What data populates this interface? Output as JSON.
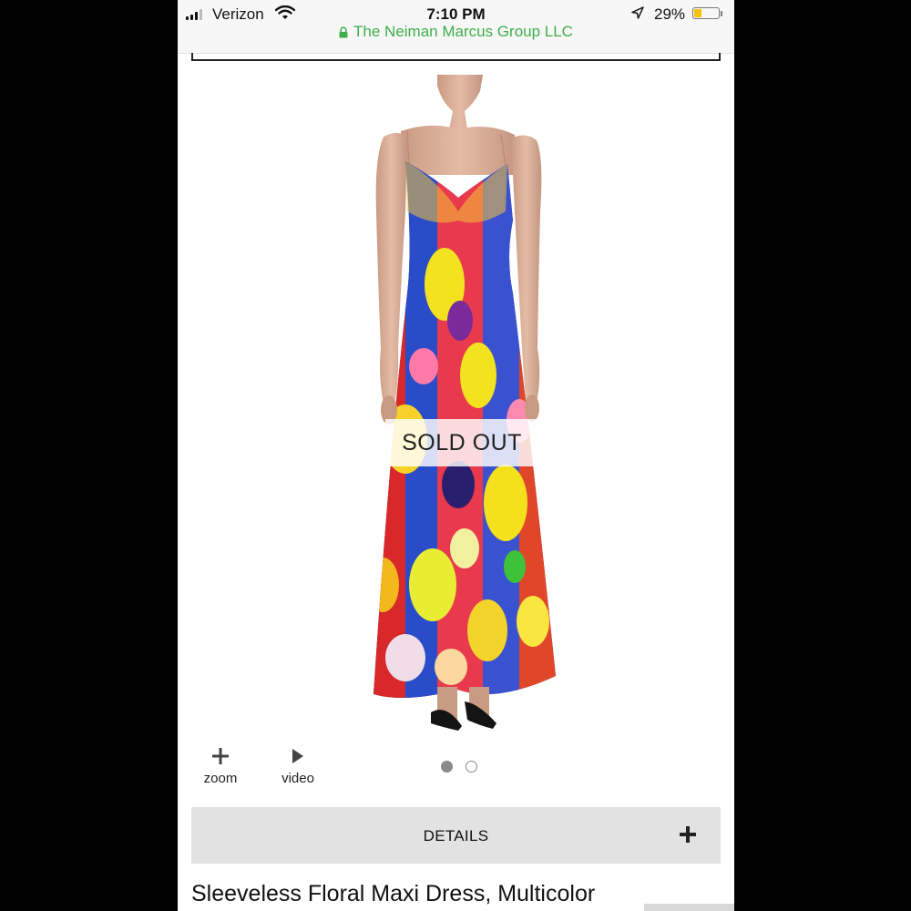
{
  "status_bar": {
    "carrier": "Verizon",
    "time": "7:10 PM",
    "site": "The Neiman Marcus Group LLC",
    "battery": "29%",
    "battery_level": 0.29,
    "icons": [
      "signal-icon",
      "wifi-icon",
      "lock-icon",
      "location-arrow-icon",
      "battery-icon"
    ]
  },
  "product": {
    "sold_out_label": "SOLD OUT",
    "title": "Sleeveless Floral Maxi Dress, Multicolor"
  },
  "image_controls": {
    "zoom_label": "zoom",
    "video_label": "video",
    "carousel": {
      "total": 2,
      "current": 1
    }
  },
  "details": {
    "label": "DETAILS",
    "icon": "plus-icon"
  },
  "colors": {
    "site_green": "#3fae4a",
    "details_bg": "#e2e2e2",
    "battery_yellow": "#f5c400"
  }
}
